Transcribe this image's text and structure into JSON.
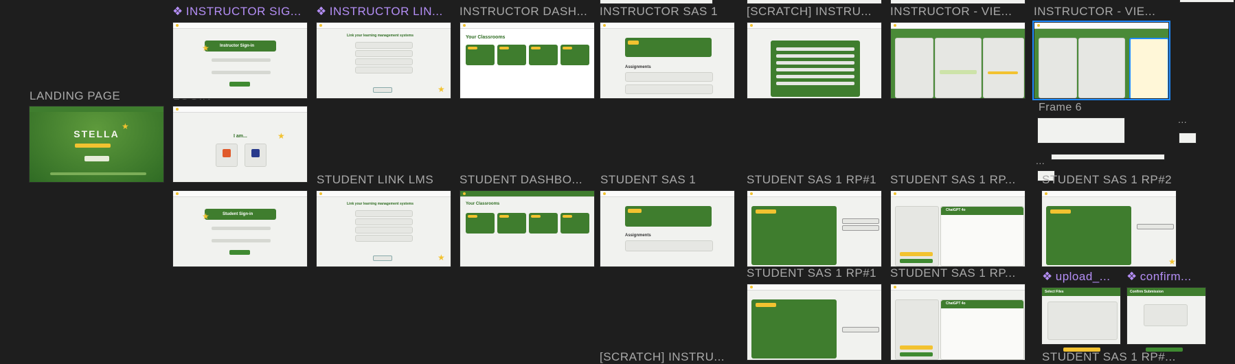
{
  "labels": {
    "landing": "LANDING PAGE",
    "login": "LOGIN",
    "instructor_signin": "INSTRUCTOR SIG...",
    "instructor_link": "INSTRUCTOR LIN...",
    "instructor_dash": "INSTRUCTOR DASH...",
    "instructor_sas1": "INSTRUCTOR SAS 1",
    "scratch1": "[SCRATCH] INSTRU...",
    "instructor_view1": "INSTRUCTOR - VIE...",
    "instructor_view2": "INSTRUCTOR - VIE...",
    "frame6": "Frame 6",
    "student_link": "STUDENT LINK LMS",
    "student_dash": "STUDENT DASHBO...",
    "student_sas1": "STUDENT SAS 1",
    "student_rp1a": "STUDENT SAS 1 RP#1",
    "student_rp1b": "STUDENT SAS 1 RP...",
    "student_rp2": "STUDENT SAS 1 RP#2",
    "student_rp1c": "STUDENT SAS 1 RP#1",
    "student_rp1d": "STUDENT SAS 1 RP...",
    "upload": "upload_...",
    "confirm": "confirm...",
    "scratch2": "[SCRATCH] INSTRU...",
    "student_rp1e": "STUDENT SAS 1 RP#..."
  },
  "thumbs": {
    "stella_name": "STELLA",
    "instructor_signin_title": "Instructor Sign-in",
    "student_signin_title": "Student Sign-in",
    "link_title": "Link your learning management systems",
    "classrooms_title": "Your Classrooms",
    "i_am": "I am...",
    "assignments": "Assignments",
    "chatgpt": "ChatGPT 4o",
    "select_files": "Select Files",
    "confirm_submission": "Confirm Submission"
  },
  "ellipsis": "..."
}
